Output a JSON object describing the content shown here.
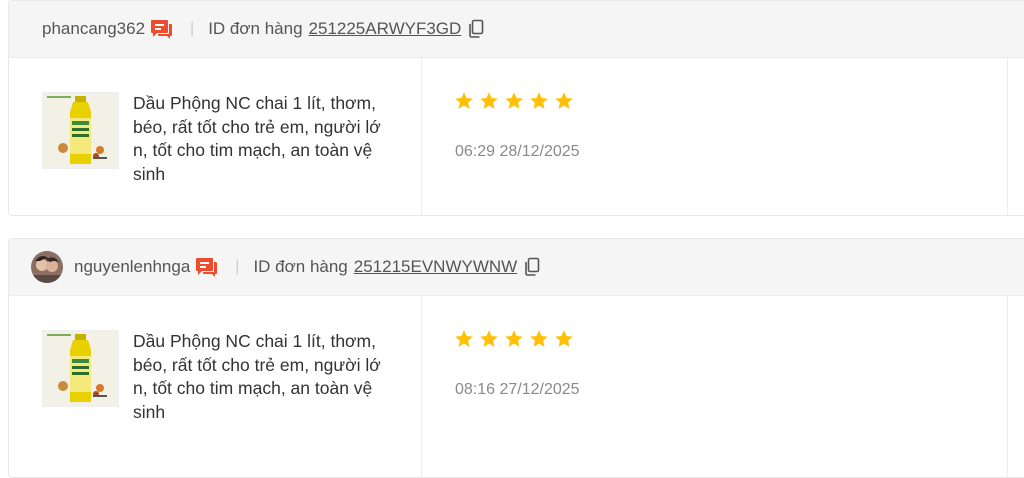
{
  "colors": {
    "accent": "#ee4d2d",
    "star": "#ffc107",
    "header_bg": "#f5f5f5",
    "muted_text": "#8a8a8a"
  },
  "reviews": [
    {
      "username": "phancang362",
      "has_avatar": false,
      "order_label": "ID đơn hàng",
      "order_id": "251225ARWYF3GD",
      "product_name": "Dầu Phộng NC chai 1 lít, thơm, béo, rất tốt cho trẻ em, người lớn, tốt cho tim mạch, an toàn vệ sinh",
      "rating": 5,
      "timestamp": "06:29 28/12/2025",
      "icons": [
        "chat-icon",
        "copy-icon",
        "star-icon"
      ]
    },
    {
      "username": "nguyenlenhnga",
      "has_avatar": true,
      "order_label": "ID đơn hàng",
      "order_id": "251215EVNWYWNW",
      "product_name": "Dầu Phộng NC chai 1 lít, thơm, béo, rất tốt cho trẻ em, người lớn, tốt cho tim mạch, an toàn vệ sinh",
      "rating": 5,
      "timestamp": "08:16 27/12/2025",
      "icons": [
        "chat-icon",
        "copy-icon",
        "star-icon"
      ]
    }
  ]
}
